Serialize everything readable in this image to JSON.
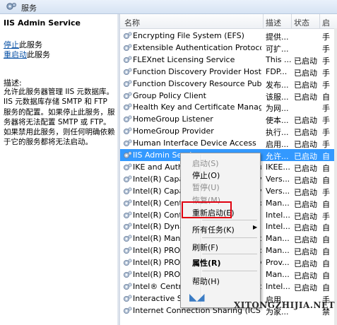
{
  "window": {
    "title": "服务"
  },
  "left": {
    "service_title": "IIS Admin Service",
    "stop_link": "停止",
    "stop_suffix": "此服务",
    "restart_link": "重启动",
    "restart_suffix": "此服务",
    "desc_label": "描述:",
    "description": "允许此服务器管理 IIS 元数据库。IIS 元数据库存储 SMTP 和 FTP 服务的配置。如果停止此服务，服务器将无法配置 SMTP 或 FTP。如果禁用此服务，则任何明确依赖于它的服务都将无法启动。"
  },
  "columns": {
    "name": "名称",
    "desc": "描述",
    "status": "状态",
    "startup": "启"
  },
  "rows": [
    {
      "name": "Encrypting File System (EFS)",
      "desc": "提供...",
      "status": "",
      "startup": "手"
    },
    {
      "name": "Extensible Authentication Protocol",
      "desc": "可扩...",
      "status": "",
      "startup": "手"
    },
    {
      "name": "FLEXnet Licensing Service",
      "desc": "This ...",
      "status": "已启动",
      "startup": "手"
    },
    {
      "name": "Function Discovery Provider Host",
      "desc": "FDP...",
      "status": "已启动",
      "startup": "手"
    },
    {
      "name": "Function Discovery Resource Publicati...",
      "desc": "发布...",
      "status": "已启动",
      "startup": "手"
    },
    {
      "name": "Group Policy Client",
      "desc": "该服...",
      "status": "已启动",
      "startup": "自"
    },
    {
      "name": "Health Key and Certificate Managem...",
      "desc": "为网...",
      "status": "",
      "startup": "手"
    },
    {
      "name": "HomeGroup Listener",
      "desc": "使本...",
      "status": "已启动",
      "startup": "手"
    },
    {
      "name": "HomeGroup Provider",
      "desc": "执行...",
      "status": "已启动",
      "startup": "手"
    },
    {
      "name": "Human Interface Device Access",
      "desc": "启用...",
      "status": "已启动",
      "startup": "手"
    },
    {
      "name": "IIS Admin Service",
      "desc": "允许...",
      "status": "已启动",
      "startup": "自"
    },
    {
      "name": "IKE and AuthIP IPsec Keying Modules",
      "desc": "IKEE...",
      "status": "已启动",
      "startup": "自"
    },
    {
      "name": "Intel(R) Capability Licensing Service",
      "desc": "Vers...",
      "status": "已启动",
      "startup": "自"
    },
    {
      "name": "Intel(R) Capability Licensing Service",
      "desc": "Vers...",
      "status": "已启动",
      "startup": "手"
    },
    {
      "name": "Intel(R) Centrino Wireless Bluetooth",
      "desc": "Man...",
      "status": "已启动",
      "startup": "自"
    },
    {
      "name": "Intel(R) Content Protection HECI",
      "desc": "Intel...",
      "status": "已启动",
      "startup": "手"
    },
    {
      "name": "Intel(R) Dynamic Platform Thermal",
      "desc": "Intel...",
      "status": "已启动",
      "startup": "自"
    },
    {
      "name": "Intel(R) Management and Security",
      "desc": "Man...",
      "status": "已启动",
      "startup": "自"
    },
    {
      "name": "Intel(R) PROSet/Wireless Event Log",
      "desc": "Man...",
      "status": "已启动",
      "startup": "自"
    },
    {
      "name": "Intel(R) PROSet/Wireless Registry",
      "desc": "Prov...",
      "status": "已启动",
      "startup": "自"
    },
    {
      "name": "Intel(R) PROSet/Wireless Zero Config",
      "desc": "Man...",
      "status": "已启动",
      "startup": "自"
    },
    {
      "name": "Intel® Centrino® Wireless Bluetooth",
      "desc": "Intel...",
      "status": "已启动",
      "startup": "自"
    },
    {
      "name": "Interactive Services Detection",
      "desc": "启用...",
      "status": "",
      "startup": "手"
    },
    {
      "name": "Internet Connection Sharing (ICS)",
      "desc": "为家...",
      "status": "",
      "startup": "禁"
    }
  ],
  "context_menu": {
    "items": [
      {
        "label": "启动(S)",
        "disabled": true
      },
      {
        "label": "停止(O)",
        "disabled": false
      },
      {
        "label": "暂停(U)",
        "disabled": true
      },
      {
        "label": "恢复(M)",
        "disabled": true
      },
      {
        "label": "重新启动(E)",
        "disabled": false
      },
      {
        "label": "所有任务(K)",
        "disabled": false
      },
      {
        "label": "刷新(F)",
        "disabled": false
      },
      {
        "label": "属性(R)",
        "disabled": false
      },
      {
        "label": "帮助(H)",
        "disabled": false
      }
    ]
  },
  "watermark": "XITONGZHIJIA.NET"
}
